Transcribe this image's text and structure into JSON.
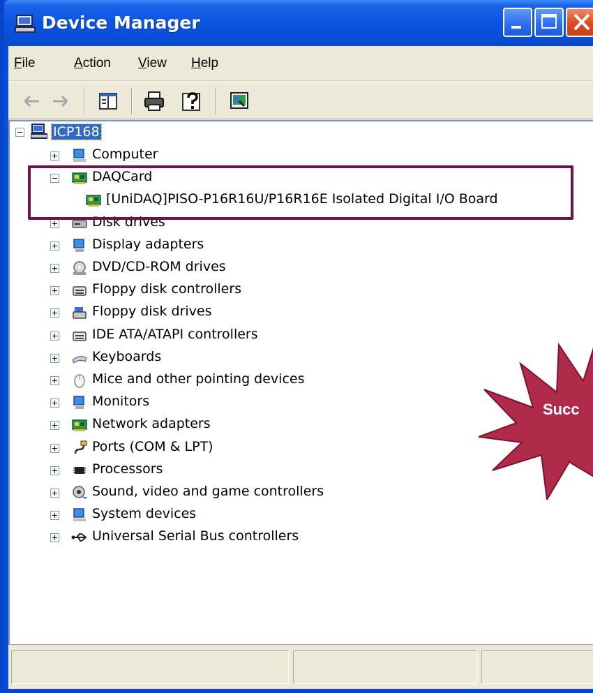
{
  "window": {
    "title": "Device Manager",
    "colors": {
      "titlebar": "#0b55e2",
      "close": "#dc4a22",
      "face": "#ece9d8",
      "highlight_border": "#6b1445",
      "burst": "#b02b4a"
    }
  },
  "menu": [
    {
      "label": "File",
      "u": "F",
      "rest": "ile"
    },
    {
      "label": "Action",
      "u": "A",
      "rest": "ction"
    },
    {
      "label": "View",
      "u": "V",
      "rest": "iew"
    },
    {
      "label": "Help",
      "u": "H",
      "rest": "elp"
    }
  ],
  "toolbar": [
    "back-arrow-icon",
    "forward-arrow-icon",
    "show-hide-console-tree-icon",
    "print-icon",
    "help-icon",
    "scan-hardware-icon"
  ],
  "tree": {
    "root": "ICP168",
    "items": [
      {
        "label": "Computer",
        "icon": "computer-icon"
      },
      {
        "label": "DAQCard",
        "icon": "pci-card-icon",
        "expanded": true,
        "children": [
          {
            "label": "[UniDAQ]PISO-P16R16U/P16R16E Isolated Digital I/O Board",
            "icon": "pci-card-icon"
          }
        ]
      },
      {
        "label": "Disk drives",
        "icon": "disk-drive-icon"
      },
      {
        "label": "Display adapters",
        "icon": "display-adapter-icon"
      },
      {
        "label": "DVD/CD-ROM drives",
        "icon": "cdrom-icon"
      },
      {
        "label": "Floppy disk controllers",
        "icon": "controller-icon"
      },
      {
        "label": "Floppy disk drives",
        "icon": "floppy-icon"
      },
      {
        "label": "IDE ATA/ATAPI controllers",
        "icon": "controller-icon"
      },
      {
        "label": "Keyboards",
        "icon": "keyboard-icon"
      },
      {
        "label": "Mice and other pointing devices",
        "icon": "mouse-icon"
      },
      {
        "label": "Monitors",
        "icon": "monitor-icon"
      },
      {
        "label": "Network adapters",
        "icon": "pci-card-icon"
      },
      {
        "label": "Ports (COM & LPT)",
        "icon": "port-icon"
      },
      {
        "label": "Processors",
        "icon": "processor-icon"
      },
      {
        "label": "Sound, video and game controllers",
        "icon": "speaker-icon"
      },
      {
        "label": "System devices",
        "icon": "system-icon"
      },
      {
        "label": "Universal Serial Bus controllers",
        "icon": "usb-icon"
      }
    ]
  },
  "callout": {
    "text": "Succ"
  }
}
